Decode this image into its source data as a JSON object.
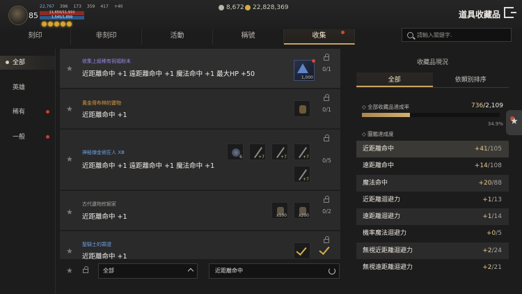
{
  "window": {
    "title": "道具收藏品"
  },
  "player": {
    "level": "85",
    "stats": [
      "22,767",
      "396",
      "173",
      "359",
      "417",
      "+40"
    ],
    "hp": "11,650/11,910",
    "mp": "1,545/1,899"
  },
  "currency": {
    "silver": "8,672",
    "gold": "22,828,369"
  },
  "tabs": [
    {
      "label": "刻印",
      "active": false,
      "dot": false
    },
    {
      "label": "非刻印",
      "active": false,
      "dot": false
    },
    {
      "label": "活動",
      "active": false,
      "dot": false
    },
    {
      "label": "稱號",
      "active": false,
      "dot": false
    },
    {
      "label": "收集",
      "active": true,
      "dot": true
    }
  ],
  "search": {
    "placeholder": "請輸入關鍵字."
  },
  "sidenav": [
    {
      "label": "全部",
      "active": true,
      "dot": false
    },
    {
      "label": "英雄",
      "active": false,
      "dot": false
    },
    {
      "label": "稀有",
      "active": false,
      "dot": true
    },
    {
      "label": "一般",
      "active": false,
      "dot": true
    }
  ],
  "entries": [
    {
      "sub": "收集上級稀有祝福粉末",
      "sub_color": "purple",
      "main": "近距離命中 +1 遠距離命中 +1 魔法命中 +1 最大HP +50",
      "count": "0/1",
      "icons": [
        {
          "kind": "rare",
          "qty": "1,000"
        }
      ]
    },
    {
      "sub": "黃金哥布林的寶物",
      "sub_color": "orange",
      "main": "近距離命中 +1",
      "count": "0/1",
      "icons": [
        {
          "kind": "shape",
          "qty": ""
        }
      ]
    },
    {
      "sub": "神秘煉金術匠人 XⅢ",
      "sub_color": "blue",
      "main": "近距離命中 +1 遠距離命中 +1 魔法命中 +1",
      "count": "0/5",
      "icons": [
        {
          "kind": "orb",
          "qty": "6"
        },
        {
          "kind": "blade",
          "qty": "+7"
        },
        {
          "kind": "blade",
          "qty": "+7"
        },
        {
          "kind": "blade",
          "qty": "+7"
        },
        {
          "kind": "blade",
          "qty": "+7"
        }
      ]
    },
    {
      "sub": "古代遺物挖掘家",
      "sub_color": "gray",
      "main": "近距離命中 +1",
      "count": "0/2",
      "icons": [
        {
          "kind": "shape",
          "qty": "x100"
        },
        {
          "kind": "shape",
          "qty": "x200"
        }
      ]
    },
    {
      "sub": "聖騎士的罪證",
      "sub_color": "blue",
      "main": "近距離命中 +1",
      "count": "",
      "icons": [
        {
          "kind": "check",
          "qty": ""
        },
        {
          "kind": "check",
          "qty": ""
        }
      ]
    }
  ],
  "filter": {
    "dropdown": "全部",
    "input": "近距離命中"
  },
  "panel": {
    "title": "收藏品現況",
    "tabs": [
      {
        "label": "全部",
        "active": true
      },
      {
        "label": "依類別排序",
        "active": false
      }
    ],
    "achievement_label": "全部收藏品達成率",
    "achievement_done": "736",
    "achievement_total": "/2,109",
    "achievement_pct": "34.9%",
    "achievement_fraction": 0.349,
    "section_label": "圖鑑達成度",
    "stats": [
      {
        "name": "近距離命中",
        "gain": "+41",
        "total": "/105"
      },
      {
        "name": "遠距離命中",
        "gain": "+14",
        "total": "/108"
      },
      {
        "name": "魔法命中",
        "gain": "+20",
        "total": "/88"
      },
      {
        "name": "近距離迴避力",
        "gain": "+1",
        "total": "/13"
      },
      {
        "name": "遠距離迴避力",
        "gain": "+1",
        "total": "/14"
      },
      {
        "name": "機率魔法迴避力",
        "gain": "+0",
        "total": "/5"
      },
      {
        "name": "無視近距離迴避力",
        "gain": "+2",
        "total": "/24"
      },
      {
        "name": "無視遠距離迴避力",
        "gain": "+2",
        "total": "/21"
      }
    ]
  }
}
